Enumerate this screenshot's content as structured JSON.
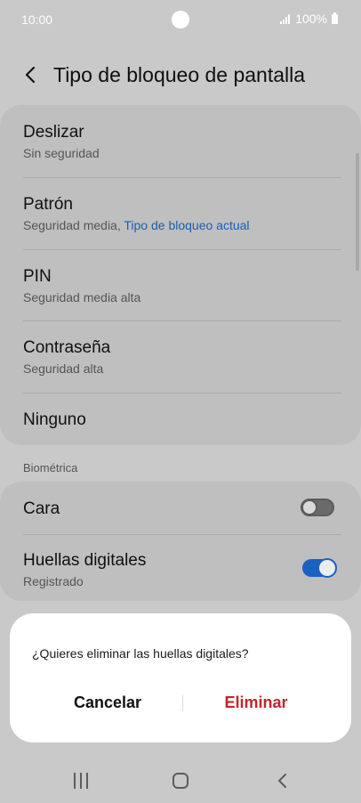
{
  "status": {
    "time": "10:00",
    "battery": "100%",
    "icons": [
      "signal-icon",
      "battery-icon"
    ]
  },
  "header": {
    "title": "Tipo de bloqueo de pantalla",
    "back_icon": "chevron-left-icon"
  },
  "lock_types": [
    {
      "title": "Deslizar",
      "subtitle": "Sin seguridad",
      "subtitle_accent": ""
    },
    {
      "title": "Patrón",
      "subtitle": "Seguridad media, ",
      "subtitle_accent": "Tipo de bloqueo actual"
    },
    {
      "title": "PIN",
      "subtitle": "Seguridad media alta",
      "subtitle_accent": ""
    },
    {
      "title": "Contraseña",
      "subtitle": "Seguridad alta",
      "subtitle_accent": ""
    },
    {
      "title": "Ninguno",
      "subtitle": "",
      "subtitle_accent": ""
    }
  ],
  "biometrics": {
    "header": "Biométrica",
    "items": [
      {
        "title": "Cara",
        "subtitle": "",
        "enabled": false
      },
      {
        "title": "Huellas digitales",
        "subtitle": "Registrado",
        "enabled": true
      }
    ]
  },
  "dialog": {
    "message": "¿Quieres eliminar las huellas digitales?",
    "cancel_label": "Cancelar",
    "confirm_label": "Eliminar"
  },
  "colors": {
    "accent": "#1a5fb4",
    "danger": "#c0262d",
    "toggle_on": "#1a62c2"
  },
  "nav": {
    "icons": [
      "recents-icon",
      "home-icon",
      "back-icon"
    ]
  }
}
